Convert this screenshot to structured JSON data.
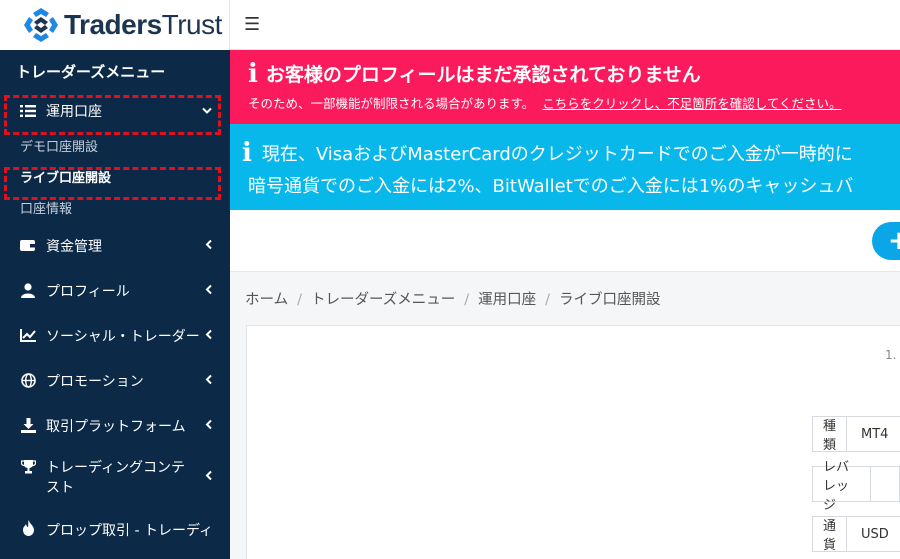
{
  "brand": {
    "name_bold": "Traders",
    "name_rest": "Trust"
  },
  "topbar": {
    "menu_icon": "☰"
  },
  "sidebar": {
    "title": "トレーダーズメニュー",
    "items": [
      {
        "label": "運用口座",
        "icon": "list-icon",
        "expanded": true
      },
      {
        "label": "資金管理",
        "icon": "wallet-icon"
      },
      {
        "label": "プロフィール",
        "icon": "user-icon"
      },
      {
        "label": "ソーシャル・トレーダー",
        "icon": "chart-line-icon"
      },
      {
        "label": "プロモーション",
        "icon": "globe-icon"
      },
      {
        "label": "取引プラットフォーム",
        "icon": "download-icon"
      },
      {
        "label": "トレーディングコンテスト",
        "icon": "trophy-icon"
      },
      {
        "label": "プロップ取引 - トレーディ",
        "icon": "fire-icon"
      }
    ],
    "subitems": [
      {
        "label": "デモ口座開設"
      },
      {
        "label": "ライブ口座開設"
      },
      {
        "label": "口座情報"
      }
    ]
  },
  "alerts": {
    "profile": {
      "title": "お客様のプロフィールはまだ承認されておりません",
      "text": "そのため、一部機能が制限される場合があります。",
      "link": "こちらをクリックし、不足箇所を確認してください。"
    },
    "notice": {
      "line1": "現在、VisaおよびMasterCardのクレジットカードでのご入金が一時的に",
      "line2": "暗号通貨でのご入金には2%、BitWalletでのご入金には1%のキャッシュバ"
    }
  },
  "action": {
    "plus": "+"
  },
  "breadcrumb": [
    "ホーム",
    "トレーダーズメニュー",
    "運用口座",
    "ライブ口座開設"
  ],
  "step": {
    "number": "1."
  },
  "form": [
    {
      "label": "種類",
      "value": "MT4"
    },
    {
      "label": "レバレッジ",
      "value": ""
    },
    {
      "label": "通貨",
      "value": "USD"
    }
  ],
  "colors": {
    "sidebar_bg": "#0c2a47",
    "alert_red": "#fb1a5b",
    "alert_blue": "#09b8eb",
    "accent": "#0aa6e8",
    "highlight_dash": "#e0101f"
  }
}
